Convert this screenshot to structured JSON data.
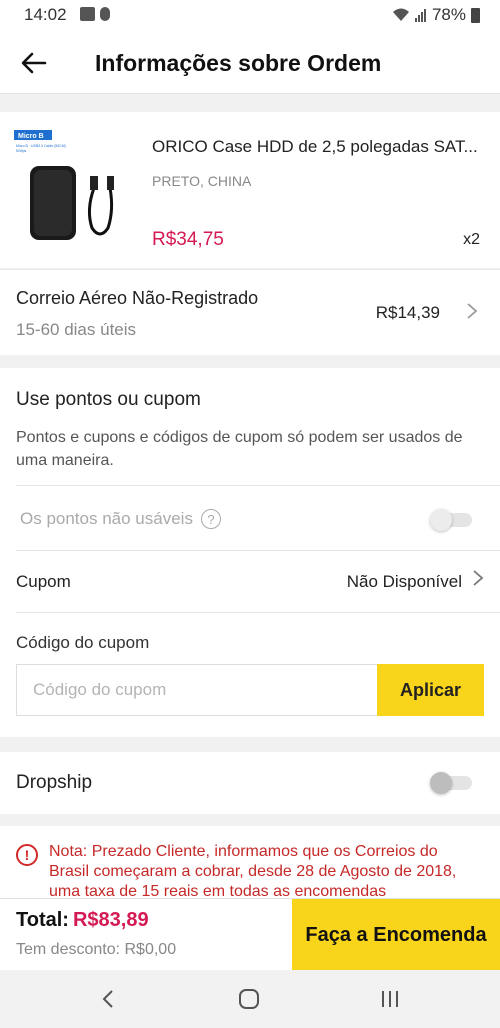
{
  "status_bar": {
    "time": "14:02",
    "battery": "78%"
  },
  "header": {
    "title": "Informações sobre Ordem"
  },
  "product": {
    "title": "ORICO Case HDD de 2,5 polegadas SAT...",
    "variant": "PRETO, CHINA",
    "price": "R$34,75",
    "qty": "x2",
    "image_text": [
      "Micro B",
      "Micro B · USB3.0 Cable (50CM)",
      "5Gbps"
    ]
  },
  "shipping": {
    "name": "Correio Aéreo Não-Registrado",
    "days": "15-60 dias úteis",
    "price": "R$14,39"
  },
  "coupon": {
    "title": "Use pontos ou cupom",
    "description": "Pontos e cupons e códigos de cupom só podem ser usados de uma maneira.",
    "points_label": "Os pontos não usáveis",
    "cupom_label": "Cupom",
    "cupom_value": "Não Disponível",
    "code_label": "Código do cupom",
    "code_placeholder": "Código do cupom",
    "apply_label": "Aplicar"
  },
  "dropship": {
    "label": "Dropship"
  },
  "note": {
    "text": "Nota: Prezado Cliente, informamos que os Correios do Brasil começaram a cobrar, desde 28 de Agosto de 2018, uma taxa de 15 reais em todas as encomendas"
  },
  "footer": {
    "total_label": "Total:",
    "total_value": "R$83,89",
    "discount_text": "Tem desconto: R$0,00",
    "order_button": "Faça a Encomenda"
  },
  "colors": {
    "accent_yellow": "#f8d51a",
    "price_red": "#d41a52",
    "note_red": "#c62828"
  }
}
